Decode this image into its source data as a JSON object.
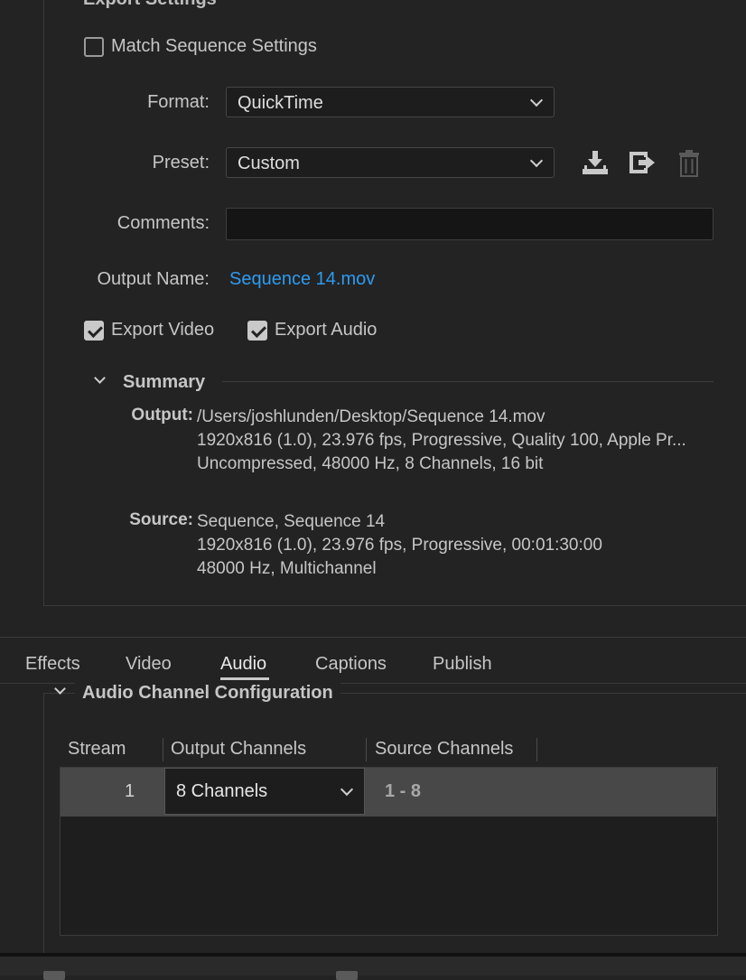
{
  "export_settings": {
    "section_title": "Export Settings",
    "match_sequence_label": "Match Sequence Settings",
    "match_sequence_checked": false,
    "format_label": "Format:",
    "format_value": "QuickTime",
    "preset_label": "Preset:",
    "preset_value": "Custom",
    "comments_label": "Comments:",
    "comments_value": "",
    "output_name_label": "Output Name:",
    "output_name_value": "Sequence 14.mov",
    "export_video_label": "Export Video",
    "export_video_checked": true,
    "export_audio_label": "Export Audio",
    "export_audio_checked": true,
    "preset_icons": [
      "import-preset-icon",
      "save-preset-icon",
      "trash-icon"
    ]
  },
  "summary": {
    "title": "Summary",
    "output_key": "Output:",
    "output_lines": [
      "/Users/joshlunden/Desktop/Sequence 14.mov",
      "1920x816 (1.0), 23.976 fps, Progressive, Quality 100, Apple Pr...",
      "Uncompressed, 48000 Hz, 8 Channels, 16 bit"
    ],
    "source_key": "Source:",
    "source_lines": [
      "Sequence, Sequence 14",
      "1920x816 (1.0), 23.976 fps, Progressive, 00:01:30:00",
      "48000 Hz, Multichannel"
    ]
  },
  "tabs": [
    {
      "label": "Effects",
      "active": false
    },
    {
      "label": "Video",
      "active": false
    },
    {
      "label": "Audio",
      "active": true
    },
    {
      "label": "Captions",
      "active": false
    },
    {
      "label": "Publish",
      "active": false
    }
  ],
  "audio_channel_config": {
    "title": "Audio Channel Configuration",
    "columns": [
      "Stream",
      "Output Channels",
      "Source Channels"
    ],
    "rows": [
      {
        "stream": "1",
        "output_channels": "8 Channels",
        "source_channels": "1 - 8"
      }
    ]
  },
  "colors": {
    "background": "#232323",
    "link": "#2d9bf0",
    "selected_row": "#484848"
  }
}
